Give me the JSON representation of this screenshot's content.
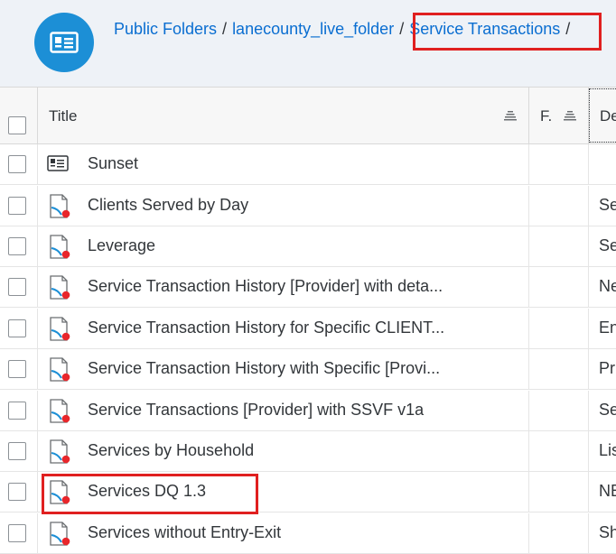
{
  "breadcrumb": {
    "items": [
      "Public Folders",
      "lanecounty_live_folder",
      "Service Transactions"
    ],
    "separator": "/"
  },
  "header": {
    "icon": "folder-card-icon"
  },
  "columns": {
    "title": "Title",
    "f": "F.",
    "description": "De"
  },
  "rows": [
    {
      "title": "Sunset",
      "desc": "",
      "icon": "folder-icon"
    },
    {
      "title": "Clients Served by Day",
      "desc": "Se",
      "icon": "report-icon"
    },
    {
      "title": "Leverage",
      "desc": "Se",
      "icon": "report-icon"
    },
    {
      "title": "Service Transaction History [Provider] with deta...",
      "desc": "Ne",
      "icon": "report-icon"
    },
    {
      "title": "Service Transaction History for Specific CLIENT...",
      "desc": "En",
      "icon": "report-icon"
    },
    {
      "title": "Service Transaction History with Specific [Provi...",
      "desc": "Pr",
      "icon": "report-icon"
    },
    {
      "title": "Service Transactions [Provider] with SSVF v1a",
      "desc": "Se",
      "icon": "report-icon"
    },
    {
      "title": "Services by Household",
      "desc": "Lis",
      "icon": "report-icon"
    },
    {
      "title": "Services DQ 1.3",
      "desc": "NE",
      "icon": "report-icon"
    },
    {
      "title": "Services without Entry-Exit",
      "desc": "Sh",
      "icon": "report-icon"
    }
  ],
  "colors": {
    "accent": "#1c8fd6",
    "link": "#0a6ed1",
    "highlight": "#e02020",
    "report_dot": "#e8262b"
  }
}
